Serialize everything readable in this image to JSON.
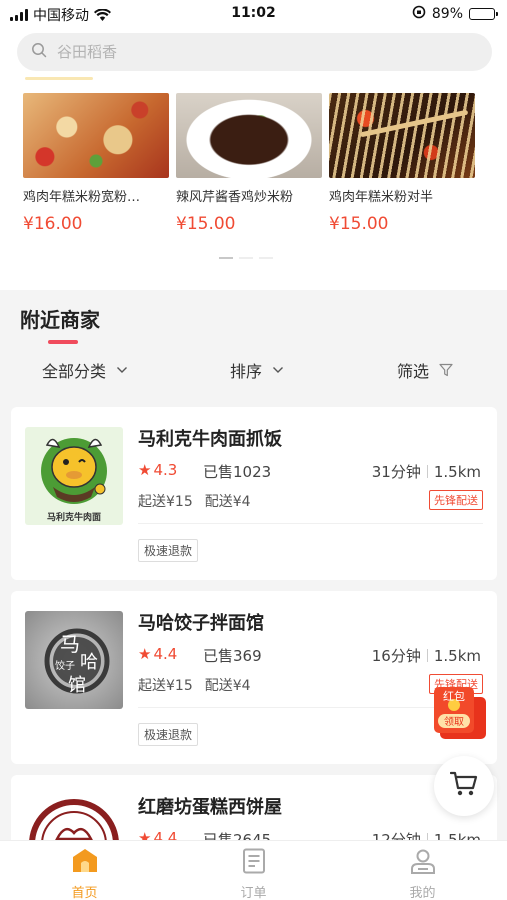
{
  "status_bar": {
    "carrier": "中国移动",
    "time": "11:02",
    "battery": "89%",
    "battery_level": 0.89
  },
  "search": {
    "placeholder": "谷田稻香"
  },
  "recommend": [
    {
      "name": "鸡肉年糕米粉宽粉…",
      "price": "¥16.00"
    },
    {
      "name": "辣风芹酱香鸡炒米粉",
      "price": "¥15.00"
    },
    {
      "name": "鸡肉年糕米粉对半",
      "price": "¥15.00"
    }
  ],
  "nearby": {
    "title": "附近商家",
    "filters": {
      "category": "全部分类",
      "sort": "排序",
      "filter": "筛选"
    }
  },
  "shops": [
    {
      "name": "马利克牛肉面抓饭",
      "rating": "4.3",
      "sold": "已售1023",
      "time": "31分钟",
      "distance": "1.5km",
      "min_order": "起送¥15",
      "delivery_fee": "配送¥4",
      "badge": "先锋配送",
      "tag": "极速退款",
      "logo_text": "马利克牛肉面"
    },
    {
      "name": "马哈饺子拌面馆",
      "rating": "4.4",
      "sold": "已售369",
      "time": "16分钟",
      "distance": "1.5km",
      "min_order": "起送¥15",
      "delivery_fee": "配送¥4",
      "badge": "先锋配送",
      "tag": "极速退款",
      "logo_text": {
        "ma": "马",
        "ha": "哈",
        "jiaozi": "饺子",
        "guan": "馆"
      }
    },
    {
      "name": "红磨坊蛋糕西饼屋",
      "rating": "4.4",
      "sold": "已售2645",
      "time": "12分钟",
      "distance": "1.5km"
    }
  ],
  "hongbao": {
    "line1": "红包",
    "line2": "领取"
  },
  "bottom_nav": [
    {
      "label": "首页",
      "icon": "home-icon",
      "active": true
    },
    {
      "label": "订单",
      "icon": "order-icon",
      "active": false
    },
    {
      "label": "我的",
      "icon": "profile-icon",
      "active": false
    }
  ],
  "colors": {
    "accent": "#f04b34",
    "nav_active": "#f39a1f",
    "underline": "#f04b5c"
  }
}
